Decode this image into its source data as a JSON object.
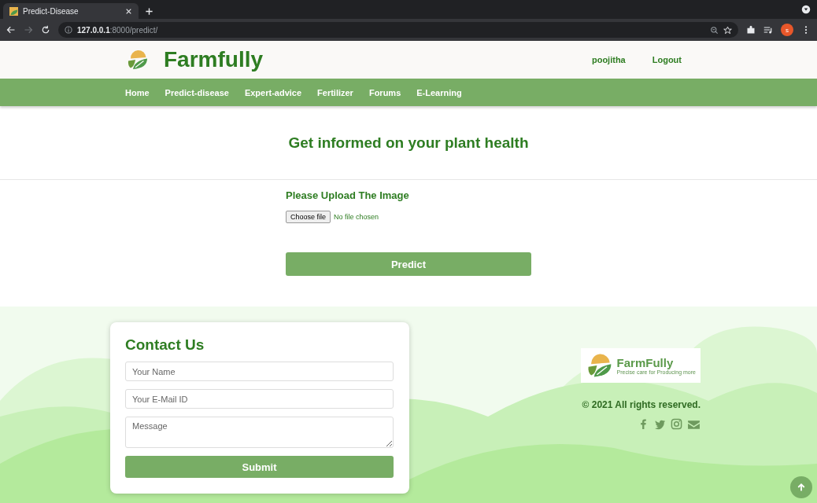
{
  "browser": {
    "tab_title": "Predict-Disease",
    "address": "**127.0.0.1**:8000/predict/",
    "profile_initial": "s"
  },
  "header": {
    "brand": "Farmfully",
    "user": "poojitha",
    "logout": "Logout"
  },
  "nav": [
    {
      "label": "Home"
    },
    {
      "label": "Predict-disease"
    },
    {
      "label": "Expert-advice"
    },
    {
      "label": "Fertilizer"
    },
    {
      "label": "Forums"
    },
    {
      "label": "E-Learning"
    }
  ],
  "hero": {
    "title": "Get informed on your plant health"
  },
  "upload": {
    "label": "Please Upload The Image",
    "file_button": "Choose file",
    "file_status": "No file chosen",
    "submit": "Predict"
  },
  "contact": {
    "title": "Contact Us",
    "fields": [
      {
        "kind": "input",
        "placeholder": "Your Name"
      },
      {
        "kind": "input",
        "placeholder": "Your E-Mail ID"
      },
      {
        "kind": "textarea",
        "placeholder": "Message"
      }
    ],
    "submit": "Submit"
  },
  "footer": {
    "logo_name": "FarmFully",
    "logo_tagline": "Precise care for Producing more",
    "copyright": "© 2021 All rights reserved."
  }
}
